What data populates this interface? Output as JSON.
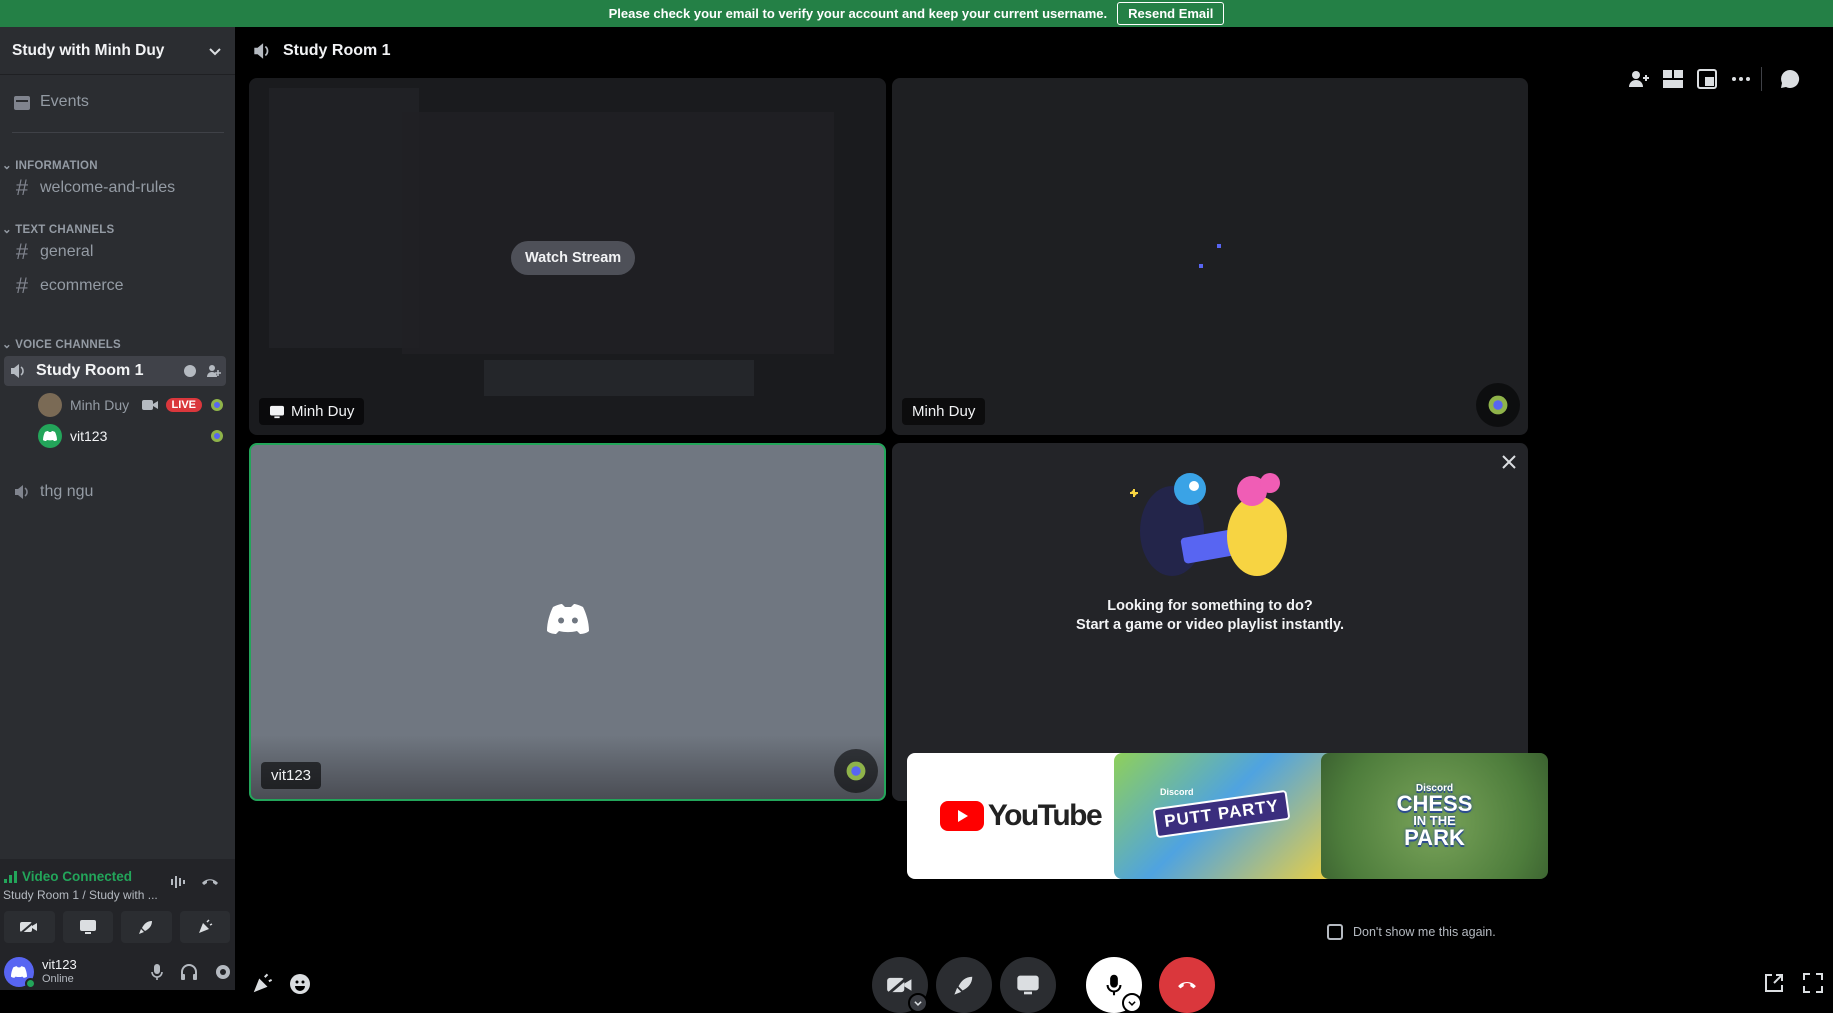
{
  "banner": {
    "text": "Please check your email to verify your account and keep your current username.",
    "button": "Resend Email"
  },
  "server": {
    "name": "Study with Minh Duy"
  },
  "sidebar": {
    "events": "Events",
    "categories": {
      "information": "INFORMATION",
      "text": "TEXT CHANNELS",
      "voice": "VOICE CHANNELS"
    },
    "channels": {
      "welcome": "welcome-and-rules",
      "general": "general",
      "ecommerce": "ecommerce"
    },
    "voice": {
      "room1": "Study Room 1",
      "users": [
        {
          "name": "Minh Duy",
          "badge": "LIVE"
        },
        {
          "name": "vit123"
        }
      ],
      "room2": "thg ngu"
    }
  },
  "voice_panel": {
    "status": "Video Connected",
    "location": "Study Room 1 / Study with ..."
  },
  "user_panel": {
    "name": "vit123",
    "status": "Online"
  },
  "topbar": {
    "title": "Study Room 1"
  },
  "tiles": {
    "stream": {
      "button": "Watch Stream",
      "name": "Minh Duy"
    },
    "camera": {
      "name": "Minh Duy"
    },
    "self": {
      "name": "vit123"
    }
  },
  "activity": {
    "line1": "Looking for something to do?",
    "line2": "Start a game or video playlist instantly.",
    "cards": {
      "youtube": "YouTube",
      "putt": "PUTT PARTY",
      "chess_top": "CHESS",
      "chess_mid": "IN THE",
      "chess_bot": "PARK",
      "discord_small": "Discord"
    },
    "checkbox": "Don't show me this again."
  },
  "colors": {
    "green": "#23a55a",
    "red": "#da373c",
    "blurple": "#5865f2"
  }
}
